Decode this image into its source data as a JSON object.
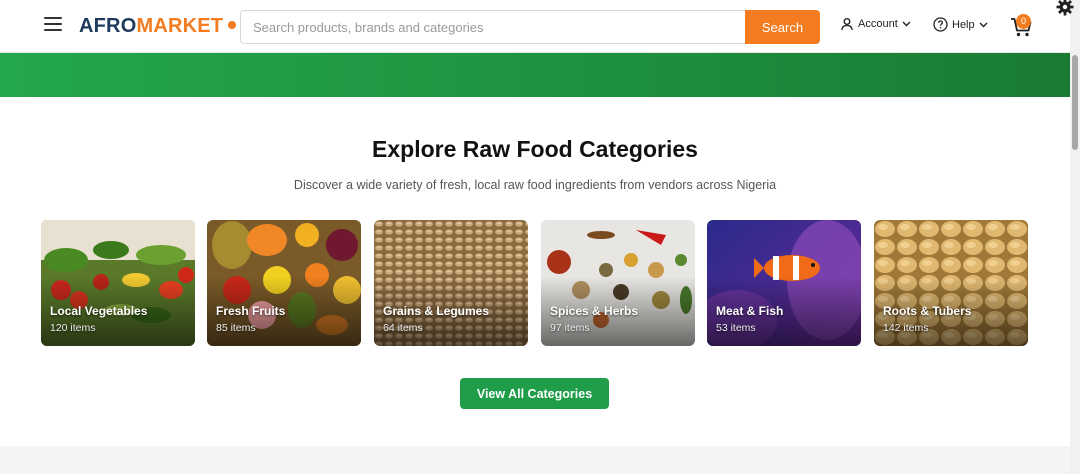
{
  "header": {
    "logo_part1": "AFRO",
    "logo_part2": "MARKET",
    "search_placeholder": "Search products, brands and categories",
    "search_button": "Search",
    "account_label": "Account",
    "help_label": "Help",
    "cart_count": "0"
  },
  "section": {
    "title": "Explore Raw Food Categories",
    "subtitle": "Discover a wide variety of fresh, local raw food ingredients from vendors across Nigeria"
  },
  "categories": [
    {
      "name": "Local Vegetables",
      "count": "120 items"
    },
    {
      "name": "Fresh Fruits",
      "count": "85 items"
    },
    {
      "name": "Grains & Legumes",
      "count": "64 items"
    },
    {
      "name": "Spices & Herbs",
      "count": "97 items"
    },
    {
      "name": "Meat & Fish",
      "count": "53 items"
    },
    {
      "name": "Roots & Tubers",
      "count": "142 items"
    }
  ],
  "view_all_button": "View All Categories",
  "colors": {
    "brand_orange": "#f47c20",
    "brand_navy": "#1e3a5f",
    "brand_green": "#1f9d48"
  }
}
